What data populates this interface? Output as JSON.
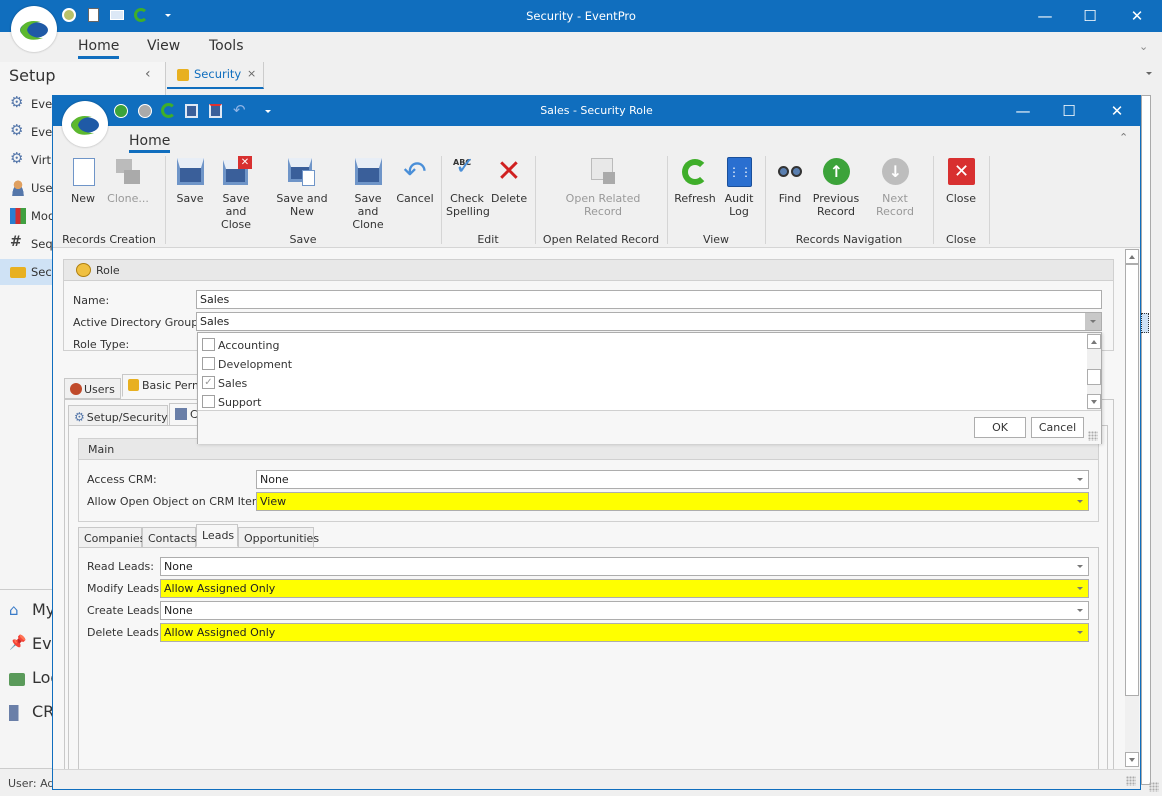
{
  "outer": {
    "title": "Security - EventPro",
    "menu_tabs": [
      "Home",
      "View",
      "Tools"
    ],
    "active_menu": "Home",
    "sidebar_title": "Setup",
    "doc_tab": "Security",
    "sidebar_items": [
      "Event",
      "Event",
      "Virtual",
      "Users",
      "Modules",
      "Sequences",
      "Security"
    ],
    "sidebar_big_items": [
      "My",
      "Event",
      "Lodging",
      "CRM"
    ],
    "status": "User: Admin"
  },
  "inner": {
    "title": "Sales - Security Role",
    "ribbon_tab": "Home",
    "ribbon_buttons": {
      "new": "New",
      "clone": "Clone...",
      "save": "Save",
      "save_close": "Save and Close",
      "save_new": "Save and New",
      "save_clone": "Save and Clone",
      "cancel": "Cancel",
      "check_spelling": "Check Spelling",
      "delete": "Delete",
      "open_related": "Open Related Record",
      "refresh": "Refresh",
      "audit_log": "Audit Log",
      "find": "Find",
      "previous": "Previous Record",
      "next": "Next Record",
      "close": "Close"
    },
    "ribbon_groups": {
      "records_creation": "Records Creation",
      "save": "Save",
      "edit": "Edit",
      "open_related": "Open Related Record",
      "view": "View",
      "navigation": "Records Navigation",
      "close": "Close"
    }
  },
  "role": {
    "header": "Role",
    "name_label": "Name:",
    "name_value": "Sales",
    "ad_label": "Active Directory Groups:",
    "ad_value": "Sales",
    "role_type_label": "Role Type:",
    "ad_options": [
      {
        "label": "Accounting",
        "checked": false
      },
      {
        "label": "Development",
        "checked": false
      },
      {
        "label": "Sales",
        "checked": true
      },
      {
        "label": "Support",
        "checked": false
      }
    ],
    "ok": "OK",
    "cancel": "Cancel"
  },
  "tabs": {
    "outer": [
      "Users",
      "Basic Permissions"
    ],
    "inner": [
      "Setup/Security",
      "CRM"
    ]
  },
  "main": {
    "header": "Main",
    "access_crm_label": "Access CRM:",
    "access_crm_value": "None",
    "open_obj_label": "Allow Open Object on CRM Items:",
    "open_obj_value": "View"
  },
  "crm_tabs": [
    "Companies",
    "Contacts",
    "Leads",
    "Opportunities"
  ],
  "active_crm_tab": "Leads",
  "leads": [
    {
      "label": "Read Leads:",
      "value": "None",
      "highlight": false
    },
    {
      "label": "Modify Leads:",
      "value": "Allow Assigned Only",
      "highlight": true
    },
    {
      "label": "Create Leads:",
      "value": "None",
      "highlight": false
    },
    {
      "label": "Delete Leads:",
      "value": "Allow Assigned Only",
      "highlight": true
    }
  ],
  "colors": {
    "accent": "#106ebe",
    "highlight": "#ffff00"
  }
}
